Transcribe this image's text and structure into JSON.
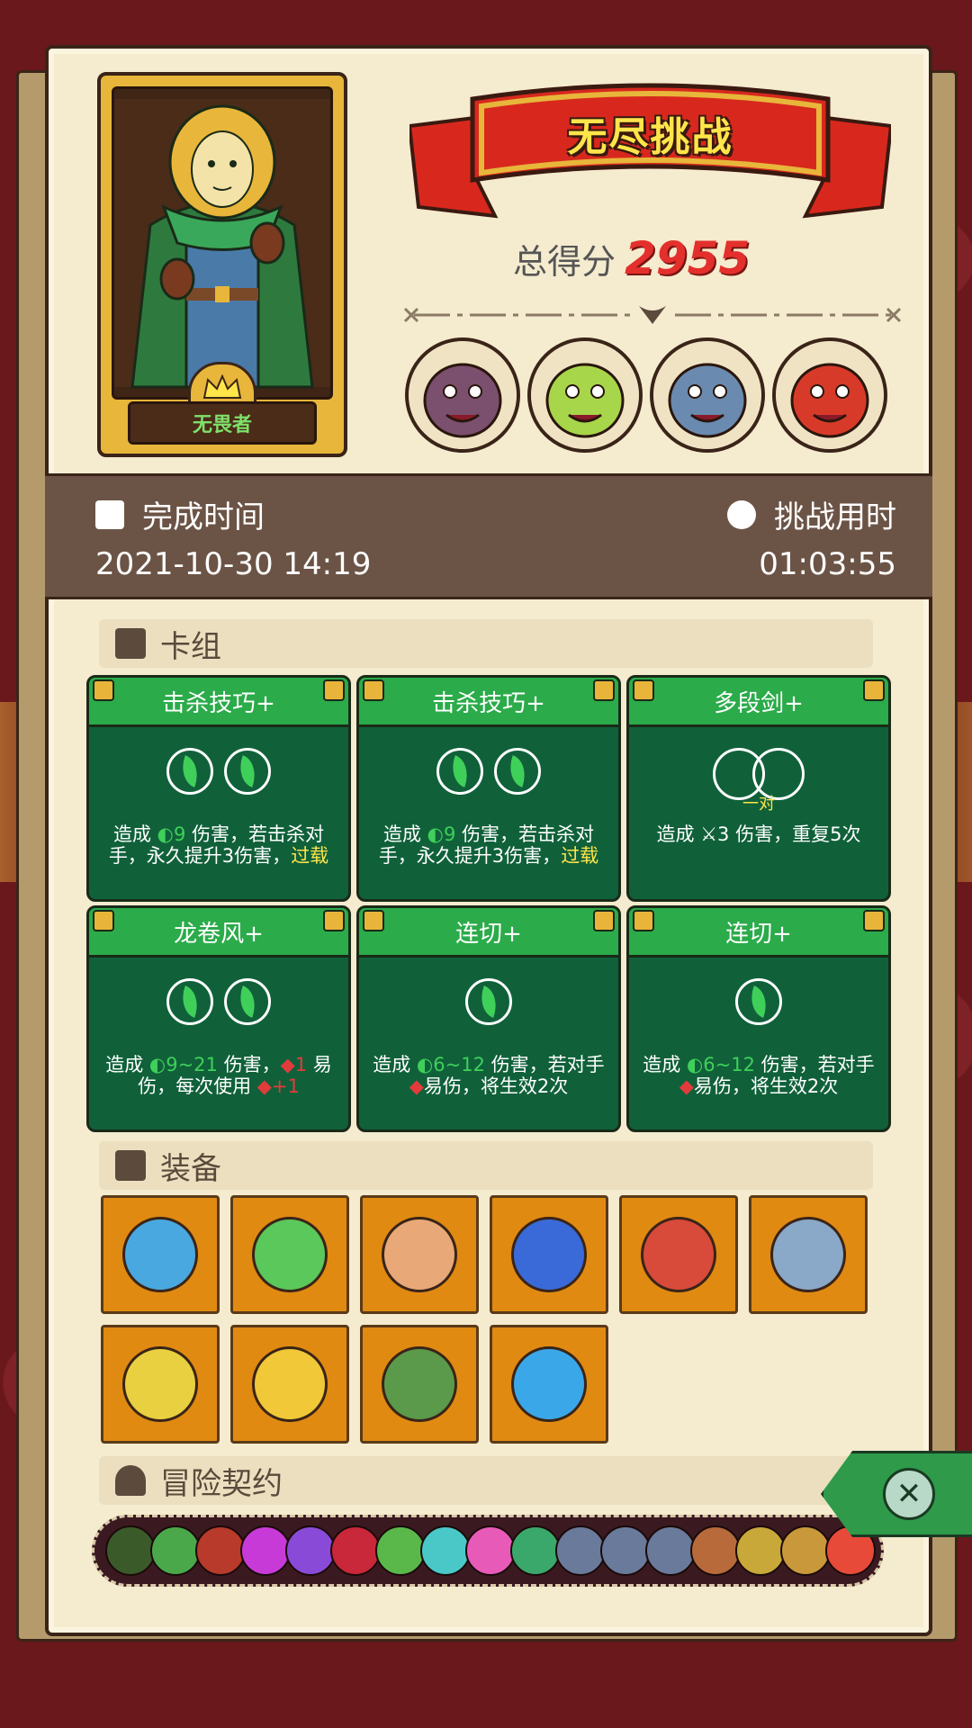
{
  "hero": {
    "name": "无畏者"
  },
  "banner": {
    "title": "无尽挑战"
  },
  "score": {
    "label": "总得分",
    "value": "2955"
  },
  "bosses": [
    {
      "icon": "stone-golem-boss-icon",
      "color": "#7b4f6e"
    },
    {
      "icon": "plant-beast-boss-icon",
      "color": "#a7d64a"
    },
    {
      "icon": "rhino-boss-icon",
      "color": "#6a8ab0"
    },
    {
      "icon": "ringmaster-boss-icon",
      "color": "#d83a2a"
    }
  ],
  "info": {
    "complete_label": "完成时间",
    "complete_value": "2021-10-30 14:19",
    "duration_label": "挑战用时",
    "duration_value": "01:03:55"
  },
  "sections": {
    "deck": "卡组",
    "equipment": "装备",
    "contract": "冒险契约"
  },
  "cards": [
    {
      "name": "击杀技巧+",
      "costs": 2,
      "desc": [
        "造成 ",
        {
          "g": "9"
        },
        " 伤害，若击杀对手，永久提升3伤害，",
        {
          "y": "过载"
        }
      ]
    },
    {
      "name": "击杀技巧+",
      "costs": 2,
      "desc": [
        "造成 ",
        {
          "g": "9"
        },
        " 伤害，若击杀对手，永久提升3伤害，",
        {
          "y": "过载"
        }
      ]
    },
    {
      "name": "多段剑+",
      "costs": 0,
      "ring_caption": "一对",
      "desc": [
        "造成 ",
        {
          "w": "3"
        },
        " 伤害，重复5次"
      ]
    },
    {
      "name": "龙卷风+",
      "costs": 2,
      "desc": [
        "造成 ",
        {
          "g": "9~21"
        },
        " 伤害，",
        {
          "r": "1"
        },
        " 易伤，每次使用 ",
        {
          "r": "+1"
        }
      ]
    },
    {
      "name": "连切+",
      "costs": 1,
      "desc": [
        "造成 ",
        {
          "g": "6~12"
        },
        " 伤害，若对手 ",
        {
          "r": ""
        },
        "易伤，将生效2次"
      ]
    },
    {
      "name": "连切+",
      "costs": 1,
      "desc": [
        "造成 ",
        {
          "g": "6~12"
        },
        " 伤害，若对手 ",
        {
          "r": ""
        },
        "易伤，将生效2次"
      ]
    }
  ],
  "equipment": [
    {
      "icon": "pumpkin-shield-icon",
      "color": "#4aa8e0"
    },
    {
      "icon": "herb-bundle-icon",
      "color": "#5ac85a"
    },
    {
      "icon": "round-shield-icon",
      "color": "#e8a878"
    },
    {
      "icon": "blue-mushroom-icon",
      "color": "#3a6ad8"
    },
    {
      "icon": "meat-leg-icon",
      "color": "#d84a3a"
    },
    {
      "icon": "horn-icon",
      "color": "#8aa8c8"
    },
    {
      "icon": "fire-feather-icon",
      "color": "#e8d040"
    },
    {
      "icon": "gold-coin-icon",
      "color": "#f0c838"
    },
    {
      "icon": "mossy-stone-icon",
      "color": "#5a9a4a"
    },
    {
      "icon": "blue-flame-crown-icon",
      "color": "#3aa8e8"
    }
  ],
  "contracts": [
    "#3a5a2a",
    "#4aa84a",
    "#b83a2a",
    "#c83ad8",
    "#8a4ad8",
    "#c8283a",
    "#5ab84a",
    "#4ac8c8",
    "#e85ab8",
    "#3aa86a",
    "#6a7a9a",
    "#6a7a9a",
    "#6a7a9a",
    "#b86a3a",
    "#c8a838",
    "#c8983a",
    "#e84a3a"
  ],
  "colors": {
    "accent": "#e3302c",
    "card_green": "#10613a",
    "equip_orange": "#e08a12"
  }
}
